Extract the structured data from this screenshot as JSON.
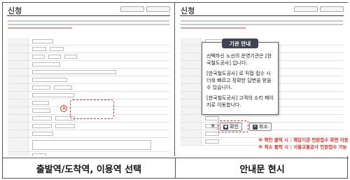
{
  "left_panel": {
    "title": "신청",
    "caption": "출발역/도착역, 이용역 선택",
    "callout_number": "③"
  },
  "right_panel": {
    "title": "신청",
    "caption": "안내문 현시",
    "callout_number": "④",
    "modal": {
      "heading": "기관 안내",
      "paragraph1": "선택하신 노선의 운영기관은 [한국철도공사] 입니다.",
      "paragraph2": "[한국철도공사] 로 직접 접수 시 더욱 빠르고 정확한 답변을 받을 수 있습니다.",
      "paragraph3": "[한국철도공사] 고객의 소리 페이지로 이동합니다.",
      "confirm_label": "확인",
      "cancel_label": "취소"
    },
    "footnotes": [
      "※ 확인 클릭 시 : 해당기관 민원접수 화면 이동",
      "※ 취소 클릭 시 : 서울교통공사 민원접수 가능"
    ]
  },
  "colors": {
    "accent_red": "#d23a3a",
    "modal_header": "#3d4552"
  }
}
